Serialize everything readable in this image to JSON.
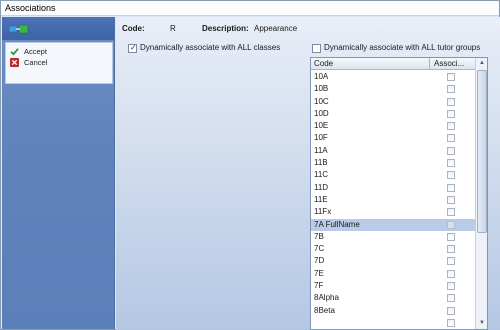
{
  "window": {
    "title": "Associations"
  },
  "sidebar": {
    "header_icon": "associate-link-icon",
    "actions": [
      {
        "label": "Accept",
        "icon": "check-icon",
        "color": "#2e9a2e"
      },
      {
        "label": "Cancel",
        "icon": "cancel-x-icon",
        "color": "#c0282d"
      }
    ]
  },
  "details": {
    "code_label": "Code:",
    "code_value": "R",
    "description_label": "Description:",
    "description_value": "Appearance"
  },
  "options": {
    "all_classes": {
      "label": "Dynamically associate with ALL classes",
      "checked": true
    },
    "all_tutor_groups": {
      "label": "Dynamically associate with ALL tutor groups",
      "checked": false
    }
  },
  "grid": {
    "columns": [
      "Code",
      "Associ..."
    ],
    "selected_row": "7A FullName",
    "rows": [
      {
        "code": "10A",
        "associated": false
      },
      {
        "code": "10B",
        "associated": false
      },
      {
        "code": "10C",
        "associated": false
      },
      {
        "code": "10D",
        "associated": false
      },
      {
        "code": "10E",
        "associated": false
      },
      {
        "code": "10F",
        "associated": false
      },
      {
        "code": "11A",
        "associated": false
      },
      {
        "code": "11B",
        "associated": false
      },
      {
        "code": "11C",
        "associated": false
      },
      {
        "code": "11D",
        "associated": false
      },
      {
        "code": "11E",
        "associated": false
      },
      {
        "code": "11Fx",
        "associated": false
      },
      {
        "code": "7A FullName",
        "associated": false
      },
      {
        "code": "7B",
        "associated": false
      },
      {
        "code": "7C",
        "associated": false
      },
      {
        "code": "7D",
        "associated": false
      },
      {
        "code": "7E",
        "associated": false
      },
      {
        "code": "7F",
        "associated": false
      },
      {
        "code": "8Alpha",
        "associated": false
      },
      {
        "code": "8Beta",
        "associated": false
      },
      {
        "code": "",
        "associated": false
      }
    ]
  }
}
